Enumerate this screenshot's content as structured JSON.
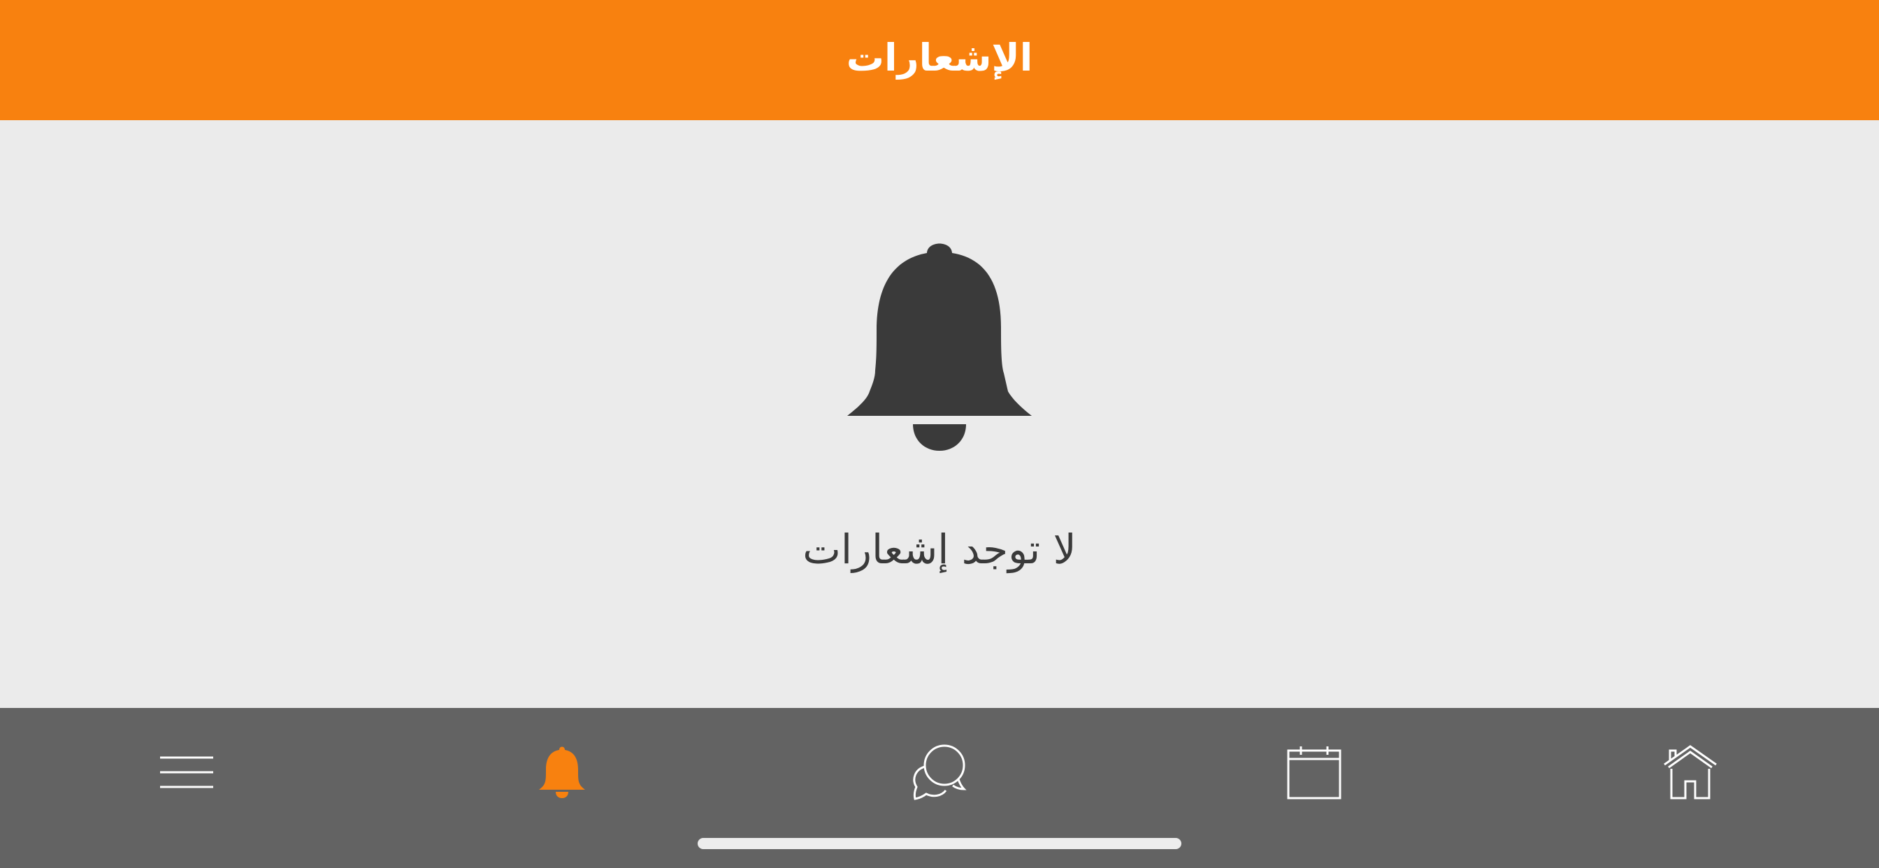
{
  "header": {
    "title": "الإشعارات"
  },
  "empty_state": {
    "icon": "bell-icon",
    "message": "لا توجد إشعارات"
  },
  "tabbar": {
    "tabs": [
      {
        "id": "menu",
        "icon": "menu-icon",
        "active": false
      },
      {
        "id": "notifications",
        "icon": "bell-icon",
        "active": true
      },
      {
        "id": "chat",
        "icon": "chat-bubbles-icon",
        "active": false
      },
      {
        "id": "calendar",
        "icon": "calendar-icon",
        "active": false
      },
      {
        "id": "home",
        "icon": "home-icon",
        "active": false
      }
    ]
  },
  "colors": {
    "accent": "#F8810F",
    "header_text": "#FFFFFF",
    "content_background": "#EBEBEB",
    "tabbar_background": "#636363",
    "icon_dark": "#3A3A3A",
    "icon_inactive": "#FFFFFF"
  }
}
